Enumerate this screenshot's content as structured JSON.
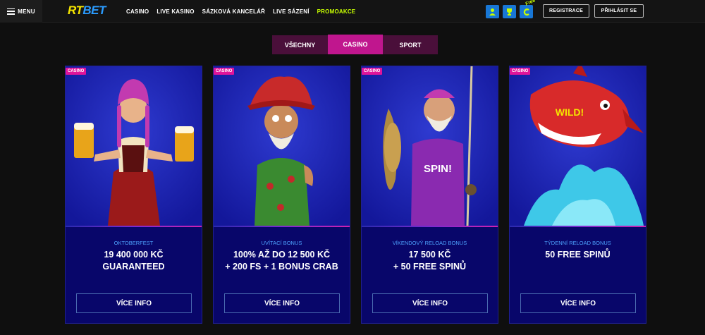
{
  "header": {
    "menu_label": "MENU",
    "logo_part1": "RT",
    "logo_part2": "BET",
    "nav": [
      "CASINO",
      "LIVE KASINO",
      "SÁZKOVÁ KANCELÁŘ",
      "LIVE SÁZENÍ",
      "PROMOAKCE"
    ],
    "free_tag": "Free",
    "register": "REGISTRACE",
    "login": "PŘIHLÁSIT SE"
  },
  "tabs": [
    "VŠECHNY",
    "CASINO",
    "SPORT"
  ],
  "active_tab": "CASINO",
  "cards": [
    {
      "badge": "CASINO",
      "subtitle": "OKTOBERFEST",
      "title": "19 400 000 KČ\nGUARANTEED",
      "button": "VÍCE INFO"
    },
    {
      "badge": "CASINO",
      "subtitle": "UVÍTACÍ BONUS",
      "title": "100% AŽ DO 12 500 KČ\n+ 200 FS + 1 BONUS CRAB",
      "button": "VÍCE INFO"
    },
    {
      "badge": "CASINO",
      "subtitle": "VÍKENDOVÝ RELOAD BONUS",
      "title": "17 500 KČ\n+ 50 FREE SPINŮ",
      "button": "VÍCE INFO"
    },
    {
      "badge": "CASINO",
      "subtitle": "TÝDENNÍ RELOAD BONUS",
      "title": "50 FREE SPINŮ",
      "button": "VÍCE INFO"
    }
  ],
  "art_text": {
    "spin": "SPIN!",
    "wild": "WILD!"
  },
  "colors": {
    "accent": "#c0168e",
    "promo": "#c8ff00",
    "card_bg": "#08066a",
    "subtitle": "#4ea4ff"
  },
  "icons": [
    "hamburger-icon",
    "user-icon",
    "trophy-icon",
    "coin-icon"
  ]
}
